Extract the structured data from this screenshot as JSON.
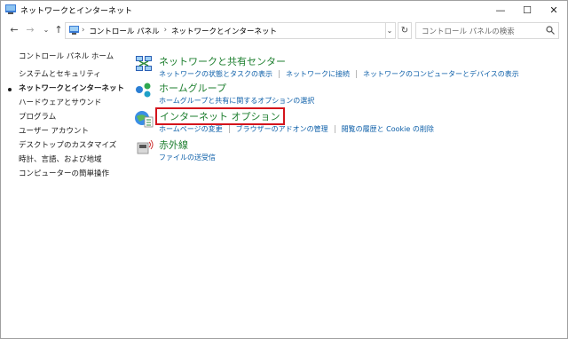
{
  "window": {
    "title": "ネットワークとインターネット"
  },
  "titlebar": {
    "minimize": "—",
    "maximize": "☐",
    "close": "✕"
  },
  "nav": {
    "back": "←",
    "forward": "→",
    "dropdown": "⌄",
    "up": "↑",
    "refresh": "↻",
    "chevron": "›"
  },
  "address": {
    "crumbs": [
      "コントロール パネル",
      "ネットワークとインターネット"
    ]
  },
  "search": {
    "placeholder": "コントロール パネルの検索"
  },
  "sidebar": {
    "home": "コントロール パネル ホーム",
    "items": [
      {
        "label": "システムとセキュリティ"
      },
      {
        "label": "ネットワークとインターネット",
        "active": true
      },
      {
        "label": "ハードウェアとサウンド"
      },
      {
        "label": "プログラム"
      },
      {
        "label": "ユーザー アカウント"
      },
      {
        "label": "デスクトップのカスタマイズ"
      },
      {
        "label": "時計、言語、および地域"
      },
      {
        "label": "コンピューターの簡単操作"
      }
    ]
  },
  "categories": [
    {
      "title": "ネットワークと共有センター",
      "icon": "network-center-icon",
      "links": [
        "ネットワークの状態とタスクの表示",
        "ネットワークに接続",
        "ネットワークのコンピューターとデバイスの表示"
      ]
    },
    {
      "title": "ホームグループ",
      "icon": "homegroup-icon",
      "links": [
        "ホームグループと共有に関するオプションの選択"
      ]
    },
    {
      "title": "インターネット オプション",
      "icon": "internet-options-icon",
      "highlighted": true,
      "links": [
        "ホームページの変更",
        "ブラウザーのアドオンの管理",
        "閲覧の履歴と Cookie の削除"
      ]
    },
    {
      "title": "赤外線",
      "icon": "infrared-icon",
      "links": [
        "ファイルの送受信"
      ]
    }
  ],
  "colors": {
    "category_title": "#1e7f2f",
    "link": "#0b5ea8",
    "highlight_border": "#d4141c"
  }
}
